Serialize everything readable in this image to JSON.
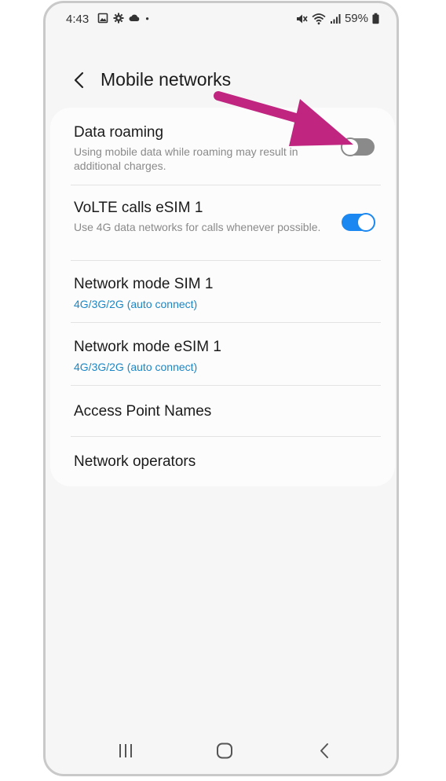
{
  "status_bar": {
    "time": "4:43",
    "battery": "59%",
    "left_icons": [
      "image-icon",
      "gear-icon",
      "cloud-icon",
      "dot-icon"
    ],
    "right_icons": [
      "mute-icon",
      "wifi-icon",
      "signal-icon",
      "battery-icon"
    ]
  },
  "header": {
    "title": "Mobile networks",
    "back_icon": "chevron-left-icon"
  },
  "settings": {
    "data_roaming": {
      "title": "Data roaming",
      "description": "Using mobile data while roaming may result in additional charges.",
      "enabled": false
    },
    "volte": {
      "title": "VoLTE calls eSIM 1",
      "description": "Use 4G data networks for calls whenever possible.",
      "enabled": true
    },
    "network_mode_sim1": {
      "title": "Network mode SIM 1",
      "value": "4G/3G/2G (auto connect)"
    },
    "network_mode_esim1": {
      "title": "Network mode eSIM 1",
      "value": "4G/3G/2G (auto connect)"
    },
    "apn": {
      "title": "Access Point Names"
    },
    "operators": {
      "title": "Network operators"
    }
  },
  "nav_bar": {
    "icons": [
      "recents-icon",
      "home-icon",
      "back-icon"
    ]
  },
  "colors": {
    "accent": "#1b87f0",
    "link": "#1b87c6",
    "annotation": "#c0257f",
    "background": "#f6f6f6",
    "card": "#fcfcfc"
  }
}
